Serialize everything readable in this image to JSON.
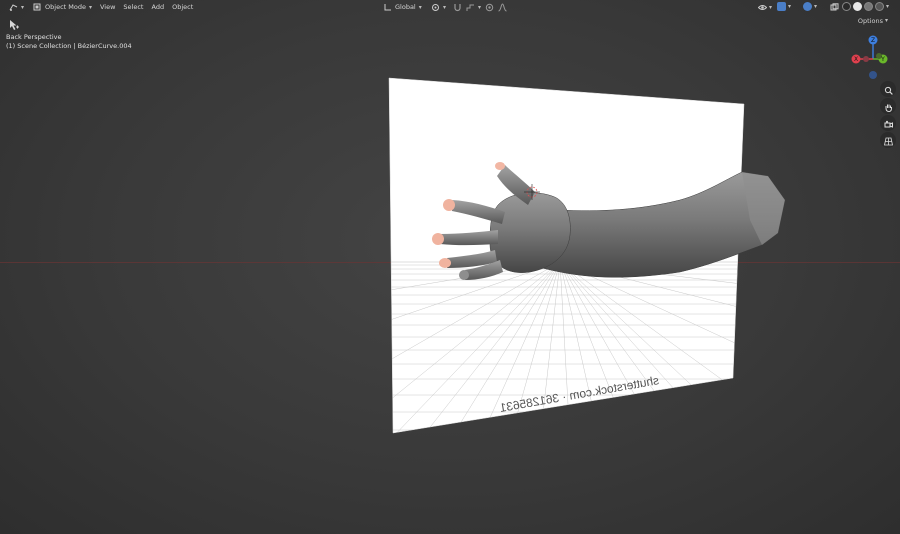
{
  "header": {
    "mode_label": "Object Mode",
    "menus": [
      "View",
      "Select",
      "Add",
      "Object"
    ],
    "orientation_label": "Global",
    "options_label": "Options"
  },
  "viewport_info": {
    "view_name": "Back Perspective",
    "collection_path": "(1) Scene Collection | BézierCurve.004"
  },
  "gizmo": {
    "axis_labels": {
      "z": "Z",
      "x": "X",
      "y": "Y"
    },
    "colors": {
      "x": "#e0404e",
      "y": "#6ab82a",
      "z": "#3d7fe0"
    }
  },
  "reference_image": {
    "watermark": "shutterstock.com · 361285631"
  }
}
